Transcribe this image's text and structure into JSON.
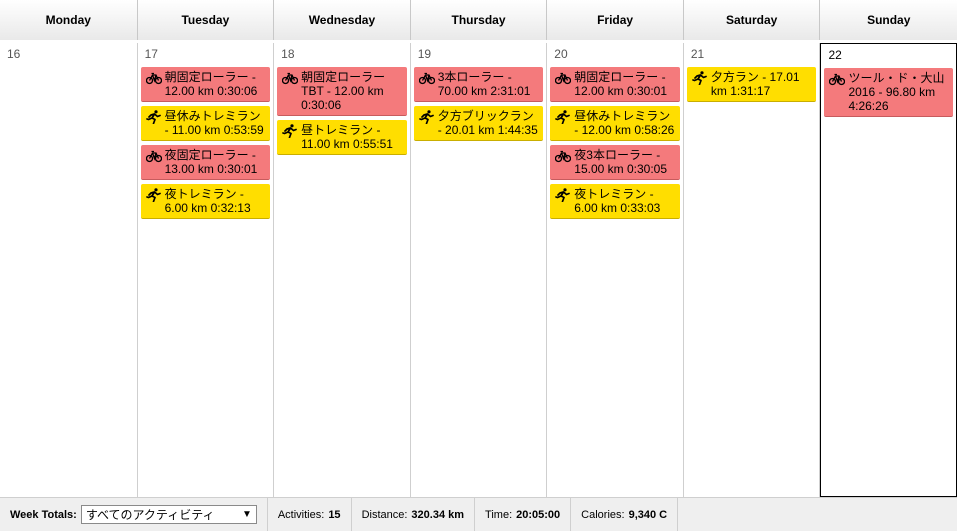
{
  "days": [
    "Monday",
    "Tuesday",
    "Wednesday",
    "Thursday",
    "Friday",
    "Saturday",
    "Sunday"
  ],
  "dates": [
    "16",
    "17",
    "18",
    "19",
    "20",
    "21",
    "22"
  ],
  "events": {
    "tue": [
      {
        "type": "bike",
        "text": "朝固定ローラー - 12.00 km 0:30:06"
      },
      {
        "type": "run",
        "text": "昼休みトレミラン - 11.00 km 0:53:59"
      },
      {
        "type": "bike",
        "text": "夜固定ローラー - 13.00 km 0:30:01"
      },
      {
        "type": "run",
        "text": "夜トレミラン - 6.00 km 0:32:13"
      }
    ],
    "wed": [
      {
        "type": "bike",
        "text": "朝固定ローラー TBT - 12.00 km 0:30:06"
      },
      {
        "type": "run",
        "text": "昼トレミラン - 11.00 km 0:55:51"
      }
    ],
    "thu": [
      {
        "type": "bike",
        "text": "3本ローラー - 70.00 km 2:31:01"
      },
      {
        "type": "run",
        "text": "夕方ブリックラン - 20.01 km 1:44:35"
      }
    ],
    "fri": [
      {
        "type": "bike",
        "text": "朝固定ローラー - 12.00 km 0:30:01"
      },
      {
        "type": "run",
        "text": "昼休みトレミラン - 12.00 km 0:58:26"
      },
      {
        "type": "bike",
        "text": "夜3本ローラー - 15.00 km 0:30:05"
      },
      {
        "type": "run",
        "text": "夜トレミラン - 6.00 km 0:33:03"
      }
    ],
    "sat": [
      {
        "type": "run",
        "text": "夕方ラン - 17.01 km 1:31:17"
      }
    ],
    "sun": [
      {
        "type": "bike",
        "text": "ツール・ド・大山 2016 - 96.80 km 4:26:26"
      }
    ]
  },
  "footer": {
    "week_totals_label": "Week Totals:",
    "filter_value": "すべてのアクティビティ",
    "activities_label": "Activities:",
    "activities_value": "15",
    "distance_label": "Distance:",
    "distance_value": "320.34 km",
    "time_label": "Time:",
    "time_value": "20:05:00",
    "calories_label": "Calories:",
    "calories_value": "9,340 C"
  },
  "icons": {
    "bike": "bicycle-icon",
    "run": "runner-icon"
  },
  "colors": {
    "bike": "#f47a7c",
    "run": "#ffde00",
    "accent": "#3fa9e0"
  }
}
